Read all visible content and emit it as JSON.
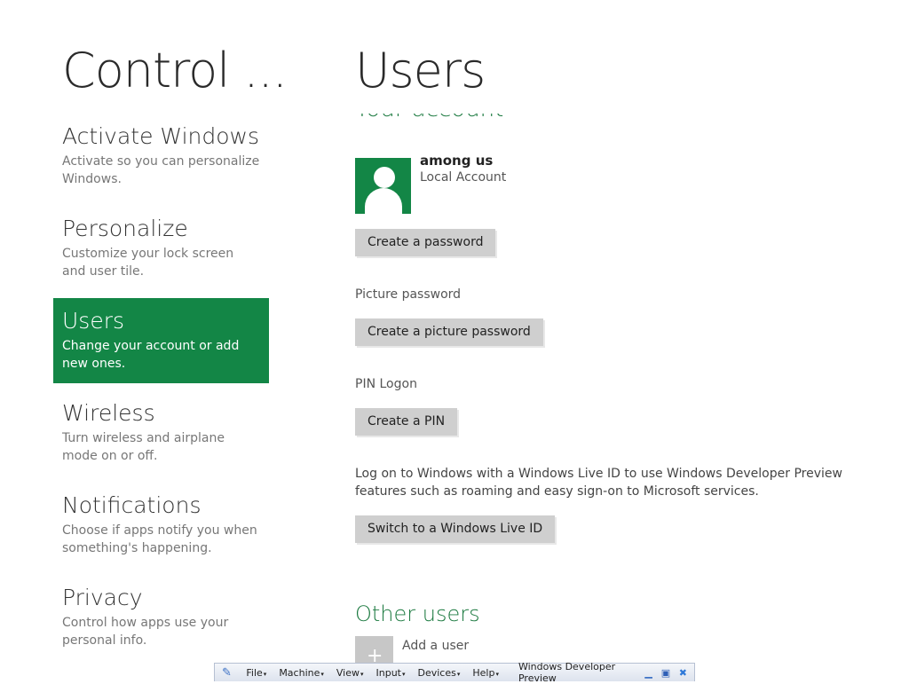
{
  "left": {
    "title": "Control ...",
    "nav": [
      {
        "name": "Activate Windows",
        "desc": "Activate so you can personalize Windows."
      },
      {
        "name": "Personalize",
        "desc": "Customize your lock screen and user tile."
      },
      {
        "name": "Users",
        "desc": "Change your account or add new ones.",
        "selected": true
      },
      {
        "name": "Wireless",
        "desc": "Turn wireless and airplane mode on or off."
      },
      {
        "name": "Notifications",
        "desc": "Choose if apps notify you when something's happening."
      },
      {
        "name": "Privacy",
        "desc": "Control how apps use your personal info."
      }
    ]
  },
  "main": {
    "title": "Users",
    "your_account_heading": "Your account",
    "account": {
      "name": "among us",
      "type": "Local Account"
    },
    "create_password_label": "Create a password",
    "picture_password_label": "Picture password",
    "create_picture_password_label": "Create a picture password",
    "pin_logon_label": "PIN Logon",
    "create_pin_label": "Create a PIN",
    "live_id_text": "Log on to Windows with a Windows Live ID to use Windows Developer Preview features such as roaming and easy sign-on to Microsoft services.",
    "switch_live_id_label": "Switch to a Windows Live ID",
    "other_users_heading": "Other users",
    "add_user_label": "Add a user"
  },
  "vm_bar": {
    "menus": [
      "File",
      "Machine",
      "View",
      "Input",
      "Devices",
      "Help"
    ],
    "title": "Windows Developer Preview"
  },
  "colors": {
    "accent": "#138646",
    "heading_green": "#1c7a40",
    "button_gray": "#cfcfcf"
  }
}
